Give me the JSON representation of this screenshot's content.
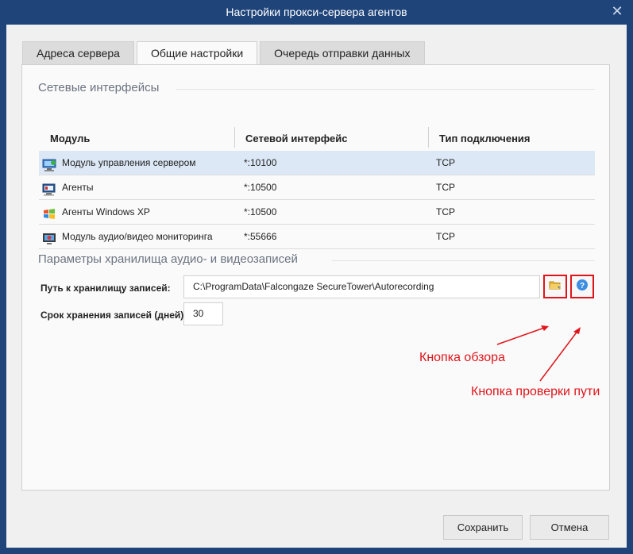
{
  "window": {
    "title": "Настройки прокси-сервера агентов",
    "close_glyph": "✕"
  },
  "tabs": [
    {
      "label": "Адреса сервера"
    },
    {
      "label": "Общие настройки"
    },
    {
      "label": "Очередь отправки данных"
    }
  ],
  "network": {
    "title": "Сетевые интерфейсы",
    "columns": [
      "Модуль",
      "Сетевой интерфейс",
      "Тип подключения"
    ],
    "rows": [
      {
        "module": "Модуль управления сервером",
        "iface": "*:10100",
        "type": "TCP",
        "icon": "server-management-icon"
      },
      {
        "module": "Агенты",
        "iface": "*:10500",
        "type": "TCP",
        "icon": "agents-icon"
      },
      {
        "module": "Агенты Windows XP",
        "iface": "*:10500",
        "type": "TCP",
        "icon": "windows-xp-icon"
      },
      {
        "module": "Модуль аудио/видео мониторинга",
        "iface": "*:55666",
        "type": "TCP",
        "icon": "av-monitoring-icon"
      }
    ]
  },
  "storage": {
    "title": "Параметры хранилища аудио- и видеозаписей",
    "path_label": "Путь к хранилищу записей:",
    "path_value": "C:\\ProgramData\\Falcongaze SecureTower\\Autorecording",
    "days_label": "Срок хранения записей (дней):",
    "days_value": "30",
    "browse_icon": "folder-browse-icon",
    "check_icon": "question-icon"
  },
  "annotations": {
    "browse": "Кнопка обзора",
    "check": "Кнопка проверки пути",
    "color": "#e0151b"
  },
  "buttons": {
    "save": "Сохранить",
    "cancel": "Отмена"
  }
}
